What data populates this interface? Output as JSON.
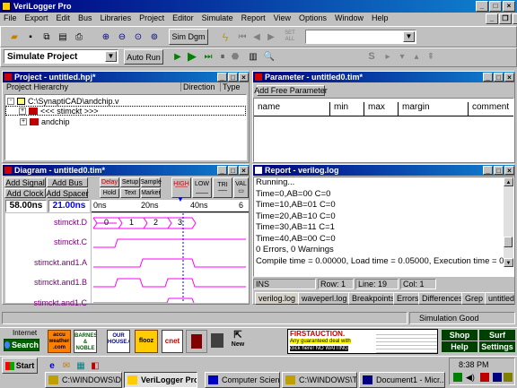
{
  "app": {
    "title": "VeriLogger Pro"
  },
  "menu": [
    "File",
    "Export",
    "Edit",
    "Bus",
    "Libraries",
    "Project",
    "Editor",
    "Simulate",
    "Report",
    "View",
    "Options",
    "Window",
    "Help"
  ],
  "toolbar": {
    "sim_dgm": "Sim Dgm",
    "set_all": "SET ALL",
    "project_mode": "Simulate Project",
    "auto_run": "Auto Run"
  },
  "project": {
    "title": "Project - untitled.hpj*",
    "col_hierarchy": "Project Hierarchy",
    "col_direction": "Direction",
    "col_type": "Type",
    "rows": [
      "C:\\SynaptiCAD\\andchip.v",
      "<<< stimckt >>>",
      "andchip"
    ]
  },
  "parameter": {
    "title": "Parameter - untitled0.tim*",
    "add_button": "Add Free Parameter",
    "columns": [
      "name",
      "min",
      "max",
      "margin",
      "comment"
    ]
  },
  "diagram": {
    "title": "Diagram - untitled0.tim*",
    "buttons": [
      "Add Signal",
      "Add Bus",
      "Add Clock",
      "Add Spacer"
    ],
    "red_buttons": [
      "Delay",
      "Setup",
      "Sample",
      "Hold",
      "Text",
      "Marker"
    ],
    "state_buttons": [
      "HIGH",
      "LOW",
      "TRI",
      "VAL"
    ],
    "time_left": "58.00ns",
    "time_right": "21.00ns",
    "ticks": [
      "0ns",
      "20ns",
      "40ns",
      "6"
    ],
    "signals": [
      "stimckt.D",
      "stimckt.C",
      "stimckt.and1.A",
      "stimckt.and1.B",
      "stimckt.and1.C"
    ],
    "bus_values": [
      "0",
      "1",
      "2",
      "3"
    ]
  },
  "report": {
    "title": "Report - verilog.log",
    "lines": [
      "Running...",
      "Time=0,AB=00 C=0",
      "Time=10,AB=01 C=0",
      "Time=20,AB=10 C=0",
      "Time=30,AB=11 C=1",
      "Time=40,AB=00 C=0",
      "0 Errors, 0 Warnings",
      "Compile time = 0.00000, Load time = 0.05000, Execution time = 0."
    ],
    "status": {
      "mode": "INS",
      "row": "Row: 1",
      "line": "Line: 19",
      "col": "Col: 1"
    },
    "tabs": [
      "verilog.log",
      "waveperl.log",
      "Breakpoints",
      "Errors",
      "Differences",
      "Grep",
      "untitled"
    ]
  },
  "statusbar": {
    "text": "Simulation Good"
  },
  "quicklaunch": {
    "internet_label": "Internet",
    "search": "Search",
    "new_label": "New",
    "shop": "Shop",
    "surf": "Surf",
    "help": "Help",
    "settings": "Settings",
    "ad1": "FIRSTAUCTION.",
    "ad2": "Any guaranteed deal with",
    "ad3": "click here! NO WAITING",
    "accu": "accu weather .com",
    "barnes": "BARNES & NOBLE",
    "ourhouse": "OUR HOUSE.COM",
    "flooz": "flooz",
    "cnet": "cnet"
  },
  "taskbar": {
    "start": "Start",
    "clock": "8:38 PM",
    "tasks": [
      "C:\\WINDOWS\\D...",
      "VeriLogger Pro",
      "Computer Science...",
      "C:\\WINDOWS\\T...",
      "Document1 - Micr..."
    ]
  },
  "colors": {
    "title_start": "#000080",
    "title_end": "#1084d0",
    "signal_label": "#800080",
    "waveform": "#ff00ff",
    "time_display": "#0000ff"
  }
}
